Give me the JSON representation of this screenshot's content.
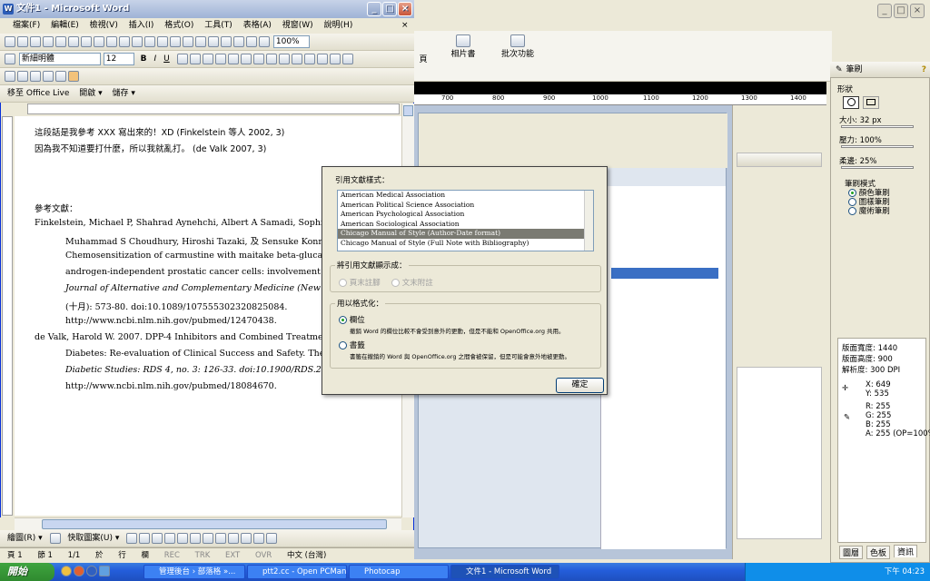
{
  "word": {
    "title": "文件1 - Microsoft Word",
    "menu": [
      "檔案(F)",
      "編輯(E)",
      "檢視(V)",
      "插入(I)",
      "格式(O)",
      "工具(T)",
      "表格(A)",
      "視窗(W)",
      "說明(H)"
    ],
    "zoom": "100%",
    "font_name": "新細明體",
    "font_size": "12",
    "toolbar3": {
      "move": "移至 Office Live",
      "open": "開啟",
      "save": "儲存"
    },
    "doc_lines": [
      "這段話是我參考 XXX 寫出來的！XD (Finkelstein  等人  2002, 3)",
      "因為我不知道要打什麼，所以我就亂打。 (de Valk 2007, 3)",
      "",
      "",
      "參考文獻：",
      "Finkelstein, Michael P, Shahrad Aynehchi, Albert A Samadi, Sophia D",
      "Muhammad S Choudhury, Hiroshi Tazaki,  及  Sensuke Konno",
      "Chemosensitization of carmustine with maitake beta-glucan o",
      "androgen-independent prostatic cancer cells: involvement of g",
      "Journal of Alternative and Complementary Medicine (New Yo",
      "(十月): 573-80. doi:10.1089/107555302320825084.",
      "http://www.ncbi.nlm.nih.gov/pubmed/12470438.",
      "de Valk, Harold W. 2007. DPP-4 Inhibitors and Combined Treatment",
      "Diabetes: Re-evaluation of Clinical Success and Safety. The R",
      "Diabetic Studies: RDS 4, no. 3: 126-33. doi:10.1900/RDS.200",
      "http://www.ncbi.nlm.nih.gov/pubmed/18084670."
    ],
    "draw_toolbar": {
      "draw": "繪圖(R)",
      "autoshapes": "快取圖案(U)"
    },
    "status": {
      "page": "頁 1",
      "section": "節 1",
      "pages": "1/1",
      "at": "於",
      "line": "行",
      "col": "欄",
      "rec": "REC",
      "trk": "TRK",
      "ext": "EXT",
      "ovr": "OVR",
      "lang": "中文 (台灣)"
    }
  },
  "bgapp": {
    "tool_labels": [
      "頁",
      "相片書",
      "批次功能"
    ],
    "ruler_ticks": [
      "700",
      "800",
      "900",
      "1000",
      "1100",
      "1200",
      "1300",
      "1400"
    ]
  },
  "pen_panel": {
    "title": "筆刷",
    "shape": "形狀",
    "size": "大小: 32 px",
    "pressure": "壓力: 100%",
    "softness": "柔邊: 25%",
    "mode_label": "筆刷模式",
    "modes": [
      "顏色筆刷",
      "圖樣筆刷",
      "魔術筆刷"
    ],
    "info": {
      "width": "版面寬度:   1440",
      "height": "版面高度:   900",
      "dpi": "解析度:   300 DPI",
      "x": "X:   649",
      "y": "Y:   535",
      "r": "R:   255",
      "g": "G:   255",
      "b": "B:   255",
      "a": "A:   255 (OP=100%)"
    },
    "tabs": [
      "圖層",
      "色板",
      "資訊"
    ]
  },
  "dialog": {
    "style_label": "引用文獻樣式：",
    "styles": [
      "American Medical Association",
      "American Political Science Association",
      "American Psychological Association",
      "American Sociological Association",
      "Chicago Manual of Style (Author-Date format)",
      "Chicago Manual of Style (Full Note with Bibliography)"
    ],
    "selected_style": "Chicago Manual of Style (Author-Date format)",
    "display_label": "將引用文獻顯示成：",
    "display_options": [
      "頁末註腳",
      "文末附註"
    ],
    "format_label": "用以格式化：",
    "format_options": [
      {
        "label": "欄位",
        "desc": "撤銷 Word 的欄位比較不會受到意外的更動，但是不能和 OpenOffice.org 共用。"
      },
      {
        "label": "書籤",
        "desc": "書籤在撤銷的 Word 與 OpenOffice.org 之間會被保留，但是可能會意外地被更動。"
      }
    ],
    "ok": "確定"
  },
  "taskbar": {
    "start": "開始",
    "tasks": [
      "管理後台 › 部落格 »...",
      "ptt2.cc - Open PCMan ...",
      "Photocap",
      "文件1 - Microsoft Word"
    ],
    "time": "下午 04:23"
  }
}
